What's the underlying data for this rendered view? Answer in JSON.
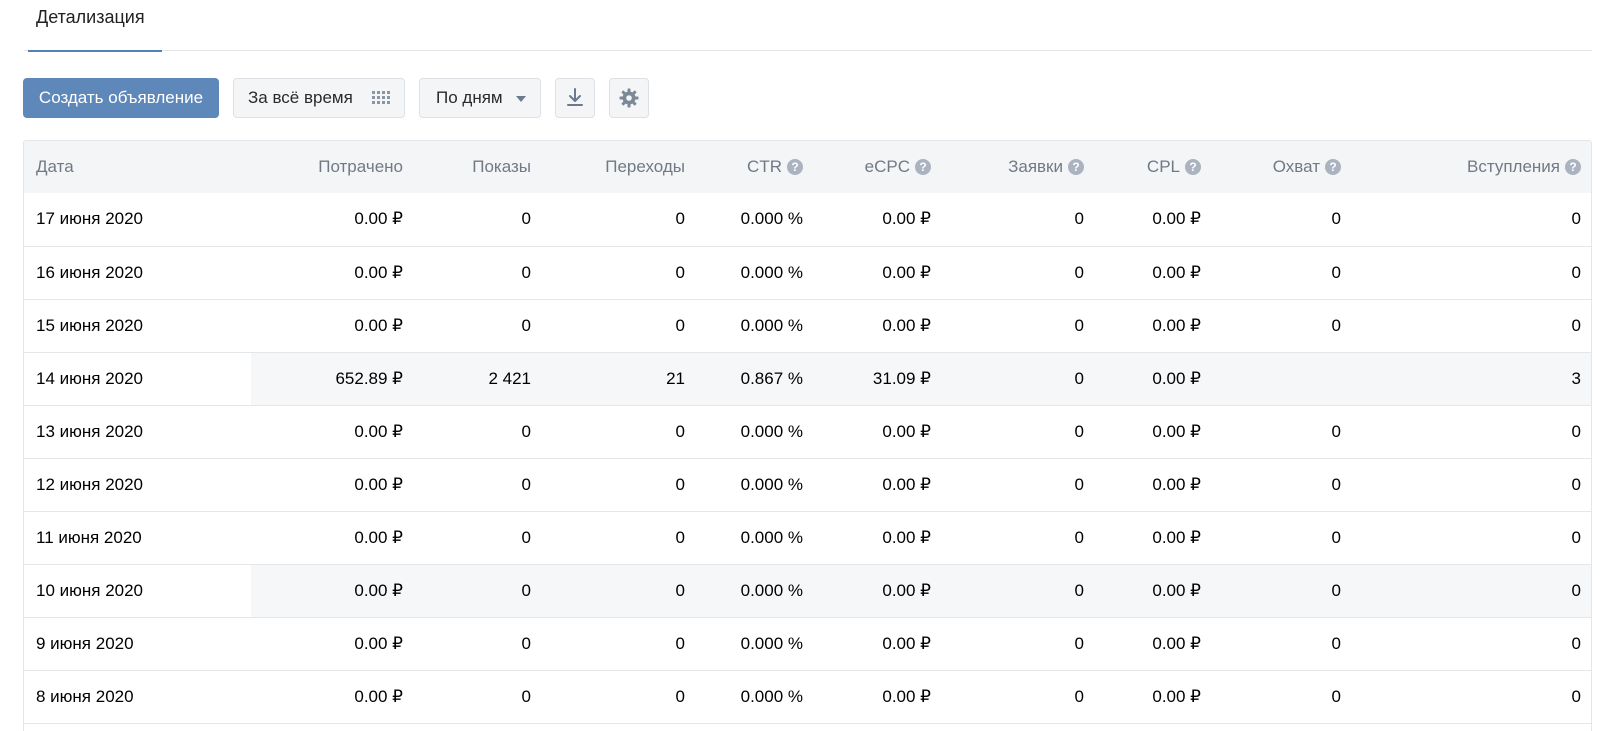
{
  "tabs": [
    {
      "label": "Детализация",
      "active": true
    }
  ],
  "toolbar": {
    "create_label": "Создать объявление",
    "period_label": "За всё время",
    "group_label": "По дням",
    "download_icon": "download-icon",
    "settings_icon": "gear-icon"
  },
  "colors": {
    "accent": "#5181b8",
    "primary_button": "#5e88ba",
    "header_bg": "#f4f5f7",
    "highlight_row": "#f6f7f9"
  },
  "table": {
    "columns": [
      {
        "label": "Дата",
        "help": false
      },
      {
        "label": "Потрачено",
        "help": false
      },
      {
        "label": "Показы",
        "help": false
      },
      {
        "label": "Переходы",
        "help": false
      },
      {
        "label": "CTR",
        "help": true
      },
      {
        "label": "eCPC",
        "help": true
      },
      {
        "label": "Заявки",
        "help": true
      },
      {
        "label": "CPL",
        "help": true
      },
      {
        "label": "Охват",
        "help": true
      },
      {
        "label": "Вступления",
        "help": true
      }
    ],
    "help_glyph": "?",
    "rows": [
      {
        "date": "17 июня 2020",
        "spent": "0.00 ₽",
        "impressions": "0",
        "clicks": "0",
        "ctr": "0.000 %",
        "ecpc": "0.00 ₽",
        "leads": "0",
        "cpl": "0.00 ₽",
        "reach": "0",
        "joins": "0"
      },
      {
        "date": "16 июня 2020",
        "spent": "0.00 ₽",
        "impressions": "0",
        "clicks": "0",
        "ctr": "0.000 %",
        "ecpc": "0.00 ₽",
        "leads": "0",
        "cpl": "0.00 ₽",
        "reach": "0",
        "joins": "0"
      },
      {
        "date": "15 июня 2020",
        "spent": "0.00 ₽",
        "impressions": "0",
        "clicks": "0",
        "ctr": "0.000 %",
        "ecpc": "0.00 ₽",
        "leads": "0",
        "cpl": "0.00 ₽",
        "reach": "0",
        "joins": "0"
      },
      {
        "date": "14 июня 2020",
        "spent": "652.89 ₽",
        "impressions": "2 421",
        "clicks": "21",
        "ctr": "0.867 %",
        "ecpc": "31.09 ₽",
        "leads": "0",
        "cpl": "0.00 ₽",
        "reach": "",
        "joins": "3",
        "highlighted": true
      },
      {
        "date": "13 июня 2020",
        "spent": "0.00 ₽",
        "impressions": "0",
        "clicks": "0",
        "ctr": "0.000 %",
        "ecpc": "0.00 ₽",
        "leads": "0",
        "cpl": "0.00 ₽",
        "reach": "0",
        "joins": "0"
      },
      {
        "date": "12 июня 2020",
        "spent": "0.00 ₽",
        "impressions": "0",
        "clicks": "0",
        "ctr": "0.000 %",
        "ecpc": "0.00 ₽",
        "leads": "0",
        "cpl": "0.00 ₽",
        "reach": "0",
        "joins": "0"
      },
      {
        "date": "11 июня 2020",
        "spent": "0.00 ₽",
        "impressions": "0",
        "clicks": "0",
        "ctr": "0.000 %",
        "ecpc": "0.00 ₽",
        "leads": "0",
        "cpl": "0.00 ₽",
        "reach": "0",
        "joins": "0"
      },
      {
        "date": "10 июня 2020",
        "spent": "0.00 ₽",
        "impressions": "0",
        "clicks": "0",
        "ctr": "0.000 %",
        "ecpc": "0.00 ₽",
        "leads": "0",
        "cpl": "0.00 ₽",
        "reach": "0",
        "joins": "0",
        "highlighted": true
      },
      {
        "date": "9 июня 2020",
        "spent": "0.00 ₽",
        "impressions": "0",
        "clicks": "0",
        "ctr": "0.000 %",
        "ecpc": "0.00 ₽",
        "leads": "0",
        "cpl": "0.00 ₽",
        "reach": "0",
        "joins": "0"
      },
      {
        "date": "8 июня 2020",
        "spent": "0.00 ₽",
        "impressions": "0",
        "clicks": "0",
        "ctr": "0.000 %",
        "ecpc": "0.00 ₽",
        "leads": "0",
        "cpl": "0.00 ₽",
        "reach": "0",
        "joins": "0"
      }
    ]
  }
}
